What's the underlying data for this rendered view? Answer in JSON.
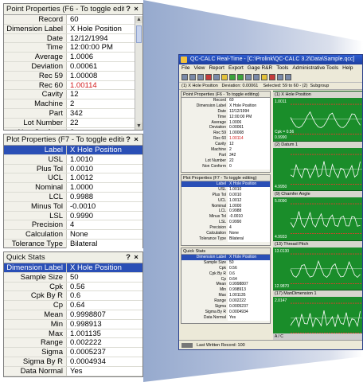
{
  "point_properties": {
    "title": "Point Properties (F6 - To toggle editing)",
    "help": "?",
    "close": "×",
    "rows": [
      {
        "k": "Record",
        "v": "60"
      },
      {
        "k": "Dimension Label",
        "v": "X Hole Position"
      },
      {
        "k": "Date",
        "v": "12/12/1994"
      },
      {
        "k": "Time",
        "v": "12:00:00 PM"
      },
      {
        "k": "Average",
        "v": "1.0006"
      },
      {
        "k": "Deviation",
        "v": "0.00061"
      },
      {
        "k": "Rec 59",
        "v": "1.00008"
      },
      {
        "k": "Rec 60",
        "v": "1.00114"
      },
      {
        "k": "Cavity",
        "v": "12"
      },
      {
        "k": "Machine",
        "v": "2"
      },
      {
        "k": "Part",
        "v": "342"
      },
      {
        "k": "Lot Number",
        "v": "22"
      },
      {
        "k": "Non Conform",
        "v": "0"
      }
    ]
  },
  "plot_properties": {
    "title": "Plot Properties (F7 - To toggle editing)",
    "help": "?",
    "close": "×",
    "rows": [
      {
        "k": "Label",
        "v": "X Hole Position"
      },
      {
        "k": "USL",
        "v": "1.0010"
      },
      {
        "k": "Plus Tol",
        "v": "0.0010"
      },
      {
        "k": "UCL",
        "v": "1.0012"
      },
      {
        "k": "Nominal",
        "v": "1.0000"
      },
      {
        "k": "LCL",
        "v": "0.9988"
      },
      {
        "k": "Minus Tol",
        "v": "-0.0010"
      },
      {
        "k": "LSL",
        "v": "0.9990"
      },
      {
        "k": "Precision",
        "v": "4"
      },
      {
        "k": "Calculation",
        "v": "None"
      },
      {
        "k": "Tolerance Type",
        "v": "Bilateral"
      }
    ]
  },
  "quick_stats": {
    "title": "Quick Stats",
    "help": "?",
    "close": "×",
    "rows": [
      {
        "k": "Dimension Label",
        "v": "X Hole Position"
      },
      {
        "k": "Sample Size",
        "v": "50"
      },
      {
        "k": "Cpk",
        "v": "0.56"
      },
      {
        "k": "Cpk By R",
        "v": "0.6"
      },
      {
        "k": "Cp",
        "v": "0.64"
      },
      {
        "k": "Mean",
        "v": "0.9998807"
      },
      {
        "k": "Min",
        "v": "0.998913"
      },
      {
        "k": "Max",
        "v": "1.001135"
      },
      {
        "k": "Range",
        "v": "0.002222"
      },
      {
        "k": "Sigma",
        "v": "0.0005237"
      },
      {
        "k": "Sigma By R",
        "v": "0.0004934"
      },
      {
        "k": "Data Normal",
        "v": "Yes"
      }
    ]
  },
  "app": {
    "title": "QC-CALC Real-Time - [C:\\Prolink\\QC-CALC 3.2\\Data\\Sample.qcc]",
    "menu": [
      "File",
      "View",
      "Report",
      "Export",
      "Gage R&R",
      "Tools",
      "Administrative Tools",
      "Help"
    ],
    "status_left": "(1) X Hole Position",
    "status_dev": "Deviation: 0.00061",
    "status_sel": "Selected: 59 to 60 - (2)",
    "status_sub": "Subgroup",
    "bottom_status": "Last Written Record: 100",
    "tabs": "A /  C"
  },
  "charts": [
    {
      "title": "(1) X Hole Position",
      "top_label": "1.0011",
      "bottom_label": "0.9990",
      "extra_label": "Cpk = 0.56"
    },
    {
      "title": "(2) Datum 1",
      "top_label": "",
      "bottom_label": "4.9950",
      "extra_label": ""
    },
    {
      "title": "(9) Chamfer Angle",
      "top_label": "5.0090",
      "bottom_label": "4.9933",
      "extra_label": ""
    },
    {
      "title": "(13) Thread Pitch",
      "top_label": "13.0130",
      "bottom_label": "12.9870",
      "extra_label": ""
    },
    {
      "title": "(17) ManDimension 1",
      "top_label": "2.0147",
      "bottom_label": "0.2285",
      "extra_label": ""
    }
  ],
  "colors": {
    "selection": "#2a4fb6",
    "highlight_value": "#d21919",
    "chart_background": "#1a8d2a",
    "titlebar": "#1e3f9f"
  }
}
